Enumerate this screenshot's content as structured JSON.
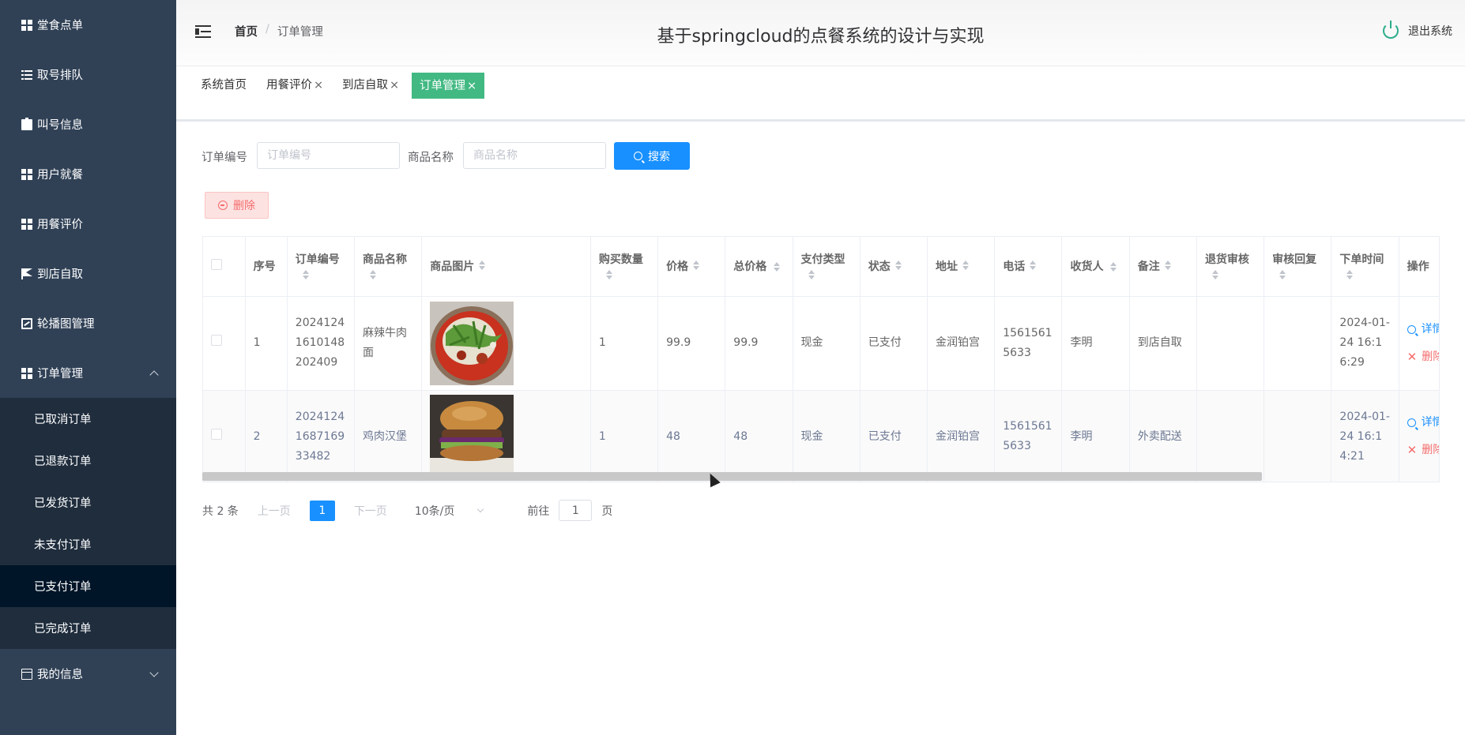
{
  "app": {
    "title": "基于springcloud的点餐系统的设计与实现",
    "logout": "退出系统"
  },
  "breadcrumb": {
    "home": "首页",
    "current": "订单管理"
  },
  "sidebar": {
    "items": [
      {
        "label": "堂食点单",
        "icon": "grid-icon"
      },
      {
        "label": "取号排队",
        "icon": "list-icon"
      },
      {
        "label": "叫号信息",
        "icon": "clipboard-icon"
      },
      {
        "label": "用户就餐",
        "icon": "grid-icon"
      },
      {
        "label": "用餐评价",
        "icon": "grid-icon"
      },
      {
        "label": "到店自取",
        "icon": "flag-icon"
      },
      {
        "label": "轮播图管理",
        "icon": "chart-icon"
      },
      {
        "label": "订单管理",
        "icon": "grid-icon"
      }
    ],
    "submenu": [
      "已取消订单",
      "已退款订单",
      "已发货订单",
      "未支付订单",
      "已支付订单",
      "已完成订单"
    ],
    "active_sub": "已支付订单",
    "bottom_item": {
      "label": "我的信息",
      "icon": "card-icon"
    }
  },
  "tags": [
    {
      "label": "系统首页",
      "closable": false
    },
    {
      "label": "用餐评价",
      "closable": true
    },
    {
      "label": "到店自取",
      "closable": true
    },
    {
      "label": "订单管理",
      "closable": true,
      "active": true
    }
  ],
  "tag_close": "×",
  "search": {
    "order_label": "订单编号",
    "order_placeholder": "订单编号",
    "product_label": "商品名称",
    "product_placeholder": "商品名称",
    "button": "搜索"
  },
  "delete_button": "删除",
  "table": {
    "headers": [
      "序号",
      "订单编号",
      "商品名称",
      "商品图片",
      "购买数量",
      "价格",
      "总价格",
      "支付类型",
      "状态",
      "地址",
      "电话",
      "收货人",
      "备注",
      "退货审核",
      "审核回复",
      "下单时间",
      "操作"
    ],
    "rows": [
      {
        "index": "1",
        "order_no": "20241241610148202409",
        "product": "麻辣牛肉面",
        "image": "spicy-beef-noodle-image",
        "qty": "1",
        "price": "99.9",
        "total": "99.9",
        "pay_type": "现金",
        "status": "已支付",
        "address": "金润铂宫",
        "phone": "15615615633",
        "receiver": "李明",
        "remark": "到店自取",
        "return_review": "",
        "review_reply": "",
        "order_time": "2024-01-24 16:16:29"
      },
      {
        "index": "2",
        "order_no": "2024124168716933482",
        "product": "鸡肉汉堡",
        "image": "chicken-burger-image",
        "qty": "1",
        "price": "48",
        "total": "48",
        "pay_type": "现金",
        "status": "已支付",
        "address": "金润铂宫",
        "phone": "15615615633",
        "receiver": "李明",
        "remark": "外卖配送",
        "return_review": "",
        "review_reply": "",
        "order_time": "2024-01-24 16:14:21"
      }
    ],
    "actions": {
      "detail": "详情",
      "delete": "删除"
    }
  },
  "pagination": {
    "total": "共 2 条",
    "prev": "上一页",
    "current_page": "1",
    "next": "下一页",
    "page_size": "10条/页",
    "goto_label": "前往",
    "goto_value": "1",
    "goto_suffix": "页"
  },
  "colors": {
    "sidebar": "#304156",
    "submenu": "#1f2d3d",
    "active_sub": "#001528",
    "primary": "#1890ff",
    "tag_active": "#42b983",
    "danger": "#f56c6c"
  }
}
